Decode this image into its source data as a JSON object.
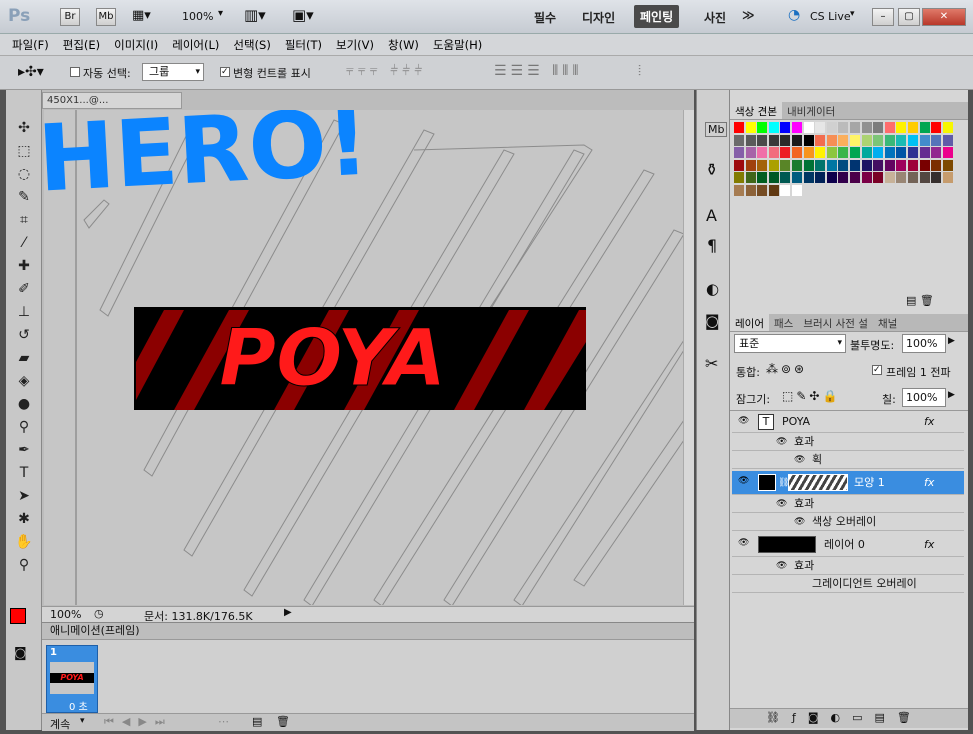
{
  "app": {
    "logo": "Ps",
    "bridge_btn": "Br",
    "minibridge_btn": "Mb",
    "zoom": "100%",
    "workspaces": [
      "필수",
      "디자인",
      "페인팅",
      "사진"
    ],
    "workspace_active": "페인팅",
    "more": "≫",
    "cs_live": "CS Live"
  },
  "menu": [
    "파일(F)",
    "편집(E)",
    "이미지(I)",
    "레이어(L)",
    "선택(S)",
    "필터(T)",
    "보기(V)",
    "창(W)",
    "도움말(H)"
  ],
  "options": {
    "auto_select_label": "자동 선택:",
    "auto_select_value": "그룹",
    "transform_label": "변형 컨트롤 표시"
  },
  "document": {
    "tab_title": "450X1...@...",
    "banner_text": "POYA",
    "overlay_text": "HERO!",
    "zoom": "100%",
    "doc_size": "문서: 131.8K/176.5K"
  },
  "animation": {
    "title": "애니메이션(프레임)",
    "frame_number": "1",
    "frame_delay": "0 초",
    "loop": "계속"
  },
  "swatches_panel": {
    "tabs": [
      "색상 견본",
      "내비게이터"
    ]
  },
  "layers_panel": {
    "tabs": [
      "레이어",
      "패스",
      "브러시 사전 설",
      "채널"
    ],
    "blend_mode": "표준",
    "opacity_label": "불투명도:",
    "opacity": "100%",
    "unify_label": "통합:",
    "frame_propagate": "프레임 1 전파",
    "lock_label": "잠그기:",
    "fill_label": "칠:",
    "fill": "100%",
    "layers": [
      {
        "name": "POYA",
        "type": "text",
        "effects_label": "효과",
        "effects": [
          "획"
        ]
      },
      {
        "name": "모양 1",
        "type": "shape",
        "selected": true,
        "effects_label": "효과",
        "effects": [
          "색상 오버레이"
        ]
      },
      {
        "name": "레이어 0",
        "type": "pixel",
        "effects_label": "효과",
        "effects": [
          "그레이디언트 오버레이"
        ]
      }
    ]
  }
}
